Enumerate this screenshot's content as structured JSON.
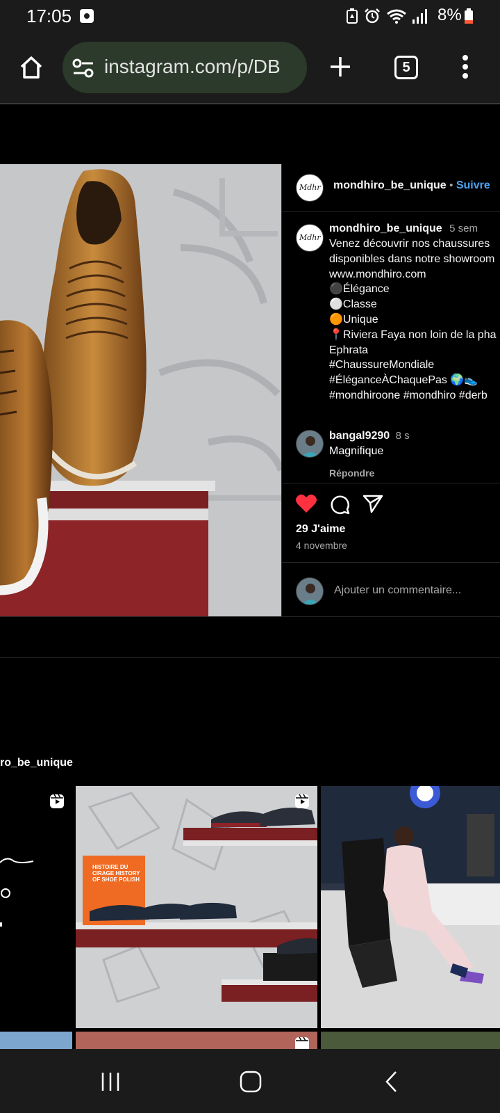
{
  "status_bar": {
    "time": "17:05",
    "battery": "8%"
  },
  "browser": {
    "url": "instagram.com/p/DB",
    "tab_count": "5"
  },
  "post": {
    "author": "mondhiro_be_unique",
    "separator": "•",
    "follow_label": "Suivre",
    "caption": {
      "author": "mondhiro_be_unique",
      "age": "5 sem",
      "lines": [
        "Venez découvrir nos chaussures",
        "disponibles dans notre showroom",
        "www.mondhiro.com",
        "⚫Élégance",
        "⚪Classe",
        "🟠Unique",
        "📍Riviera Faya non loin de la pha",
        "Ephrata",
        "#ChaussureMondiale",
        "#ÉléganceÀChaquePas 🌍👟",
        "#mondhiroone #mondhiro #derb"
      ]
    },
    "comment": {
      "user": "bangal9290",
      "age": "8 s",
      "text": "Magnifique",
      "reply_label": "Répondre"
    },
    "likes": "29 J'aime",
    "date": "4 novembre",
    "comment_placeholder": "Ajouter un commentaire..."
  },
  "profile_section": {
    "handle": "ro_be_unique",
    "grid_text": {
      "book_title": "HISTOIRE DU CIRAGE HISTORY OF SHOE POLISH"
    }
  },
  "icons": {
    "home": "home-icon",
    "site_settings": "tune-icon",
    "new_tab": "plus-icon",
    "menu": "more-vert-icon",
    "like": "heart-filled-icon",
    "comment": "comment-icon",
    "share": "share-icon",
    "reel": "reel-icon"
  },
  "colors": {
    "like": "#ff3040",
    "link": "#4aa3f5",
    "url_bar": "#2b3a2a"
  }
}
